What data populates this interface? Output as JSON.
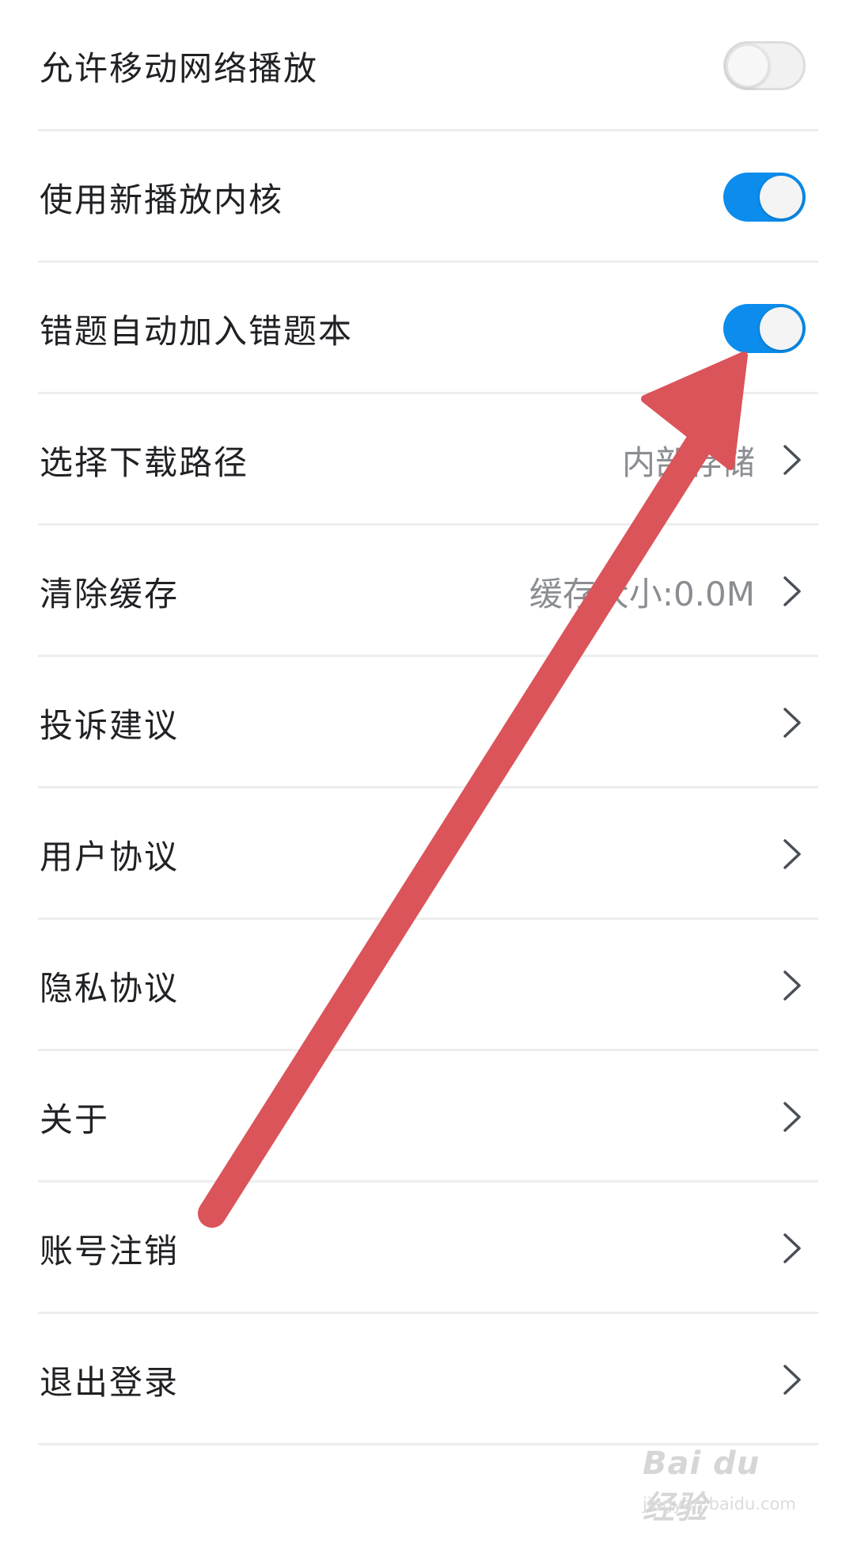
{
  "settings": {
    "items": [
      {
        "label": "允许移动网络播放",
        "type": "toggle",
        "on": false
      },
      {
        "label": "使用新播放内核",
        "type": "toggle",
        "on": true
      },
      {
        "label": "错题自动加入错题本",
        "type": "toggle",
        "on": true
      },
      {
        "label": "选择下载路径",
        "type": "link",
        "value": "内部存储"
      },
      {
        "label": "清除缓存",
        "type": "link",
        "value": "缓存大小:0.0M"
      },
      {
        "label": "投诉建议",
        "type": "link"
      },
      {
        "label": "用户协议",
        "type": "link"
      },
      {
        "label": "隐私协议",
        "type": "link"
      },
      {
        "label": "关于",
        "type": "link"
      },
      {
        "label": "账号注销",
        "type": "link"
      },
      {
        "label": "退出登录",
        "type": "link"
      }
    ]
  },
  "colors": {
    "toggle_on": "#0c8ded",
    "toggle_off": "#f1f1f2",
    "annotation_arrow": "#db545a",
    "divider": "#ededee"
  },
  "icons": {
    "chevron": "chevron-right-icon"
  },
  "watermark": {
    "logo_text": "Bai du 经验",
    "url": "jingyan.baidu.com"
  }
}
